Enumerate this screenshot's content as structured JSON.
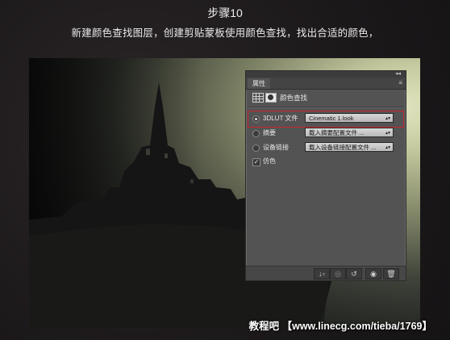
{
  "step": {
    "title": "步骤10",
    "description": "新建颜色查找图层，创建剪贴蒙板使用颜色查找，找出合适的颜色，"
  },
  "panel": {
    "tab_label": "属性",
    "header_title": "颜色查找",
    "collapse_icon": "collapse-icon",
    "menu_icon": "panel-menu-icon",
    "options": [
      {
        "label": "3DLUT 文件",
        "value": "Cinematic 1.look",
        "selected": true
      },
      {
        "label": "摘要",
        "value": "载入摘要配置文件 ...",
        "selected": false
      },
      {
        "label": "设备链接",
        "value": "载入设备链接配置文件 ...",
        "selected": false
      }
    ],
    "dither_label": "仿色",
    "dither_checked": true,
    "highlight_color": "#c8262e"
  },
  "watermark": "教程吧 【www.linecg.com/tieba/1769】"
}
